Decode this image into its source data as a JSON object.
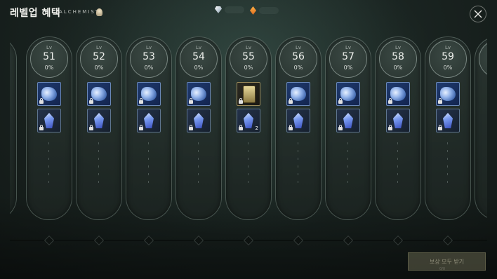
{
  "header": {
    "title": "레벨업 혜택",
    "subtitle": "ALCHEMIST",
    "close_icon": "close-icon"
  },
  "currency": [
    {
      "icon": "diamond-icon"
    },
    {
      "icon": "orange-gem-icon"
    }
  ],
  "levels": [
    {
      "lv_label": "Lv",
      "level": "51",
      "progress": "0%",
      "rewards": [
        {
          "icon": "blue-scroll-icon",
          "locked": true
        },
        {
          "icon": "blue-crystal-icon",
          "locked": true
        }
      ]
    },
    {
      "lv_label": "Lv",
      "level": "52",
      "progress": "0%",
      "rewards": [
        {
          "icon": "blue-scroll-icon",
          "locked": true
        },
        {
          "icon": "blue-crystal-icon",
          "locked": true
        }
      ]
    },
    {
      "lv_label": "Lv",
      "level": "53",
      "progress": "0%",
      "rewards": [
        {
          "icon": "blue-scroll-icon",
          "locked": true
        },
        {
          "icon": "blue-crystal-icon",
          "locked": true
        }
      ]
    },
    {
      "lv_label": "Lv",
      "level": "54",
      "progress": "0%",
      "rewards": [
        {
          "icon": "blue-scroll-icon",
          "locked": true
        },
        {
          "icon": "blue-crystal-icon",
          "locked": true
        }
      ]
    },
    {
      "lv_label": "Lv",
      "level": "55",
      "progress": "0%",
      "rewards": [
        {
          "icon": "gold-card-icon",
          "locked": true
        },
        {
          "icon": "blue-crystal-icon",
          "locked": true,
          "quantity": "2"
        }
      ]
    },
    {
      "lv_label": "Lv",
      "level": "56",
      "progress": "0%",
      "rewards": [
        {
          "icon": "blue-scroll-icon",
          "locked": true
        },
        {
          "icon": "blue-crystal-icon",
          "locked": true
        }
      ]
    },
    {
      "lv_label": "Lv",
      "level": "57",
      "progress": "0%",
      "rewards": [
        {
          "icon": "blue-scroll-icon",
          "locked": true
        },
        {
          "icon": "blue-crystal-icon",
          "locked": true
        }
      ]
    },
    {
      "lv_label": "Lv",
      "level": "58",
      "progress": "0%",
      "rewards": [
        {
          "icon": "blue-scroll-icon",
          "locked": true
        },
        {
          "icon": "blue-crystal-icon",
          "locked": true
        }
      ]
    },
    {
      "lv_label": "Lv",
      "level": "59",
      "progress": "0%",
      "rewards": [
        {
          "icon": "blue-scroll-icon",
          "locked": true
        },
        {
          "icon": "blue-crystal-icon",
          "locked": true
        }
      ]
    }
  ],
  "footer": {
    "claim_all_label": "보상 모두 받기",
    "claim_all_sub": "0/0"
  },
  "colors": {
    "background": "#1a2421",
    "card_border": "#96aaa0",
    "reward_blue": "#1f3a6e",
    "reward_gold_border": "#9a8a5a"
  }
}
